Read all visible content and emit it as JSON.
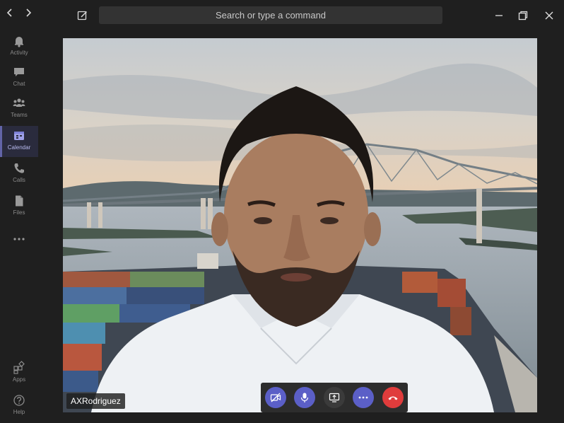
{
  "titlebar": {
    "back_icon": "chevron-left-icon",
    "forward_icon": "chevron-right-icon",
    "compose_icon": "compose-icon",
    "search_placeholder": "Search or type a command",
    "window_controls": [
      "minimize-icon",
      "restore-icon",
      "close-icon"
    ]
  },
  "rail": {
    "items": [
      {
        "label": "Activity",
        "icon": "bell-icon"
      },
      {
        "label": "Chat",
        "icon": "chat-icon"
      },
      {
        "label": "Teams",
        "icon": "teams-icon"
      },
      {
        "label": "Calendar",
        "icon": "calendar-icon",
        "active": true
      },
      {
        "label": "Calls",
        "icon": "phone-icon"
      },
      {
        "label": "Files",
        "icon": "file-icon"
      }
    ],
    "more_icon": "ellipsis-icon",
    "apps_label": "Apps",
    "help_label": "Help"
  },
  "call": {
    "participant_name": "AXRodriguez",
    "controls": [
      "camera-off-icon",
      "microphone-icon",
      "share-screen-icon",
      "more-icon",
      "hang-up-icon"
    ]
  },
  "colors": {
    "accent": "#5b5fc7",
    "hangup": "#e03c3c",
    "background": "#1f1f1f"
  }
}
